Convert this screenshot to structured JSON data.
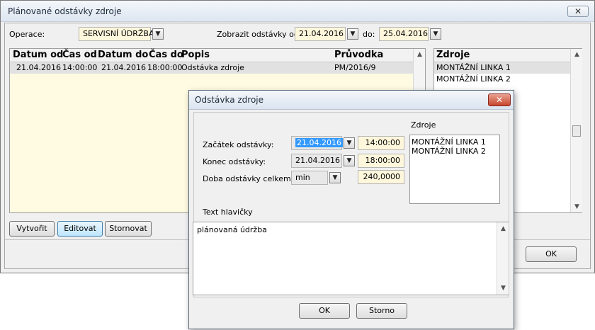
{
  "main": {
    "title": "Plánované odstávky zdroje",
    "close_label": "✕",
    "operace_label": "Operace:",
    "operace_value": "SERVISNÍ ÚDRŽBA",
    "zobrazit_label": "Zobrazit odstávky od:",
    "date_from": "21.04.2016",
    "do_label": "do:",
    "date_to": "25.04.2016",
    "grid": {
      "columns": [
        "Datum od",
        "Čas od",
        "Datum do",
        "Čas do",
        "Popis",
        "Průvodka"
      ],
      "rows": [
        [
          "21.04.2016",
          "14:00:00",
          "21.04.2016",
          "18:00:00",
          "Odstávka zdroje",
          "PM/2016/9"
        ]
      ]
    },
    "zdroje": {
      "header": "Zdroje",
      "items": [
        "MONTÁŽNÍ LINKA 1",
        "MONTÁŽNÍ LINKA 2"
      ]
    },
    "buttons": {
      "vytvorit": "Vytvořit",
      "editovat": "Editovat",
      "stornovat": "Stornovat",
      "ok": "OK"
    }
  },
  "dialog": {
    "title": "Odstávka zdroje",
    "close_label": "✕",
    "zacatek_label": "Začátek odstávky:",
    "zacatek_date": "21.04.2016",
    "zacatek_time": "14:00:00",
    "konec_label": "Konec odstávky:",
    "konec_date": "21.04.2016",
    "konec_time": "18:00:00",
    "doba_label": "Doba odstávky celkem:",
    "doba_unit": "min",
    "doba_value": "240,0000",
    "zdroje_label": "Zdroje",
    "zdroje_items": [
      "MONTÁŽNÍ LINKA 1",
      "MONTÁŽNÍ LINKA 2"
    ],
    "text_hlavicky_label": "Text hlavičky",
    "text_hlavicky_value": "plánovaná údržba",
    "ok_label": "OK",
    "storno_label": "Storno"
  },
  "icons": {
    "dropdown": "▼",
    "scroll_up": "▲",
    "scroll_down": "▼"
  }
}
